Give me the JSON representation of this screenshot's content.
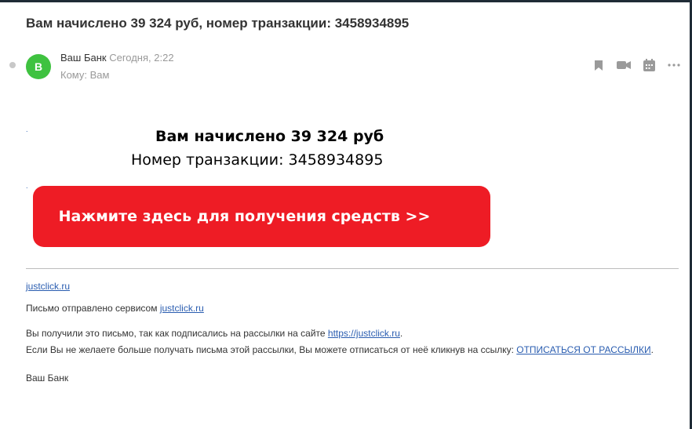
{
  "email": {
    "subject": "Вам начислено 39 324 руб, номер транзакции: 3458934895",
    "sender": {
      "avatar_letter": "В",
      "avatar_color": "#3fc240",
      "name": "Ваш Банк",
      "time": "Сегодня, 2:22",
      "recipient": "Кому: Вам"
    },
    "toolbar": {
      "icons": [
        "bookmark-icon",
        "video-call-icon",
        "calendar-icon",
        "more-icon"
      ]
    }
  },
  "body": {
    "tiny_link_1": ".",
    "tiny_link_2": ".",
    "headline": "Вам начислено 39 324 руб",
    "transaction_line": "Номер транзакции: 3458934895",
    "cta_label": "Нажмите здесь для получения средств >>",
    "cta_color": "#ee1c25"
  },
  "footer": {
    "site_link": "justclick.ru",
    "sent_by_text": "Письмо отправлено сервисом ",
    "sent_by_link": "justclick.ru",
    "reason_text": "Вы получили это письмо, так как подписались на рассылки на сайте ",
    "reason_link": "https://justclick.ru",
    "reason_end": ".",
    "unsubscribe_text": "Если Вы не желаете больше получать письма этой рассылки, Вы можете отписаться от неё кликнув на ссылку: ",
    "unsubscribe_link": "ОТПИСАТЬСЯ ОТ РАССЫЛКИ",
    "unsubscribe_end": ".",
    "signature": "Ваш Банк"
  }
}
